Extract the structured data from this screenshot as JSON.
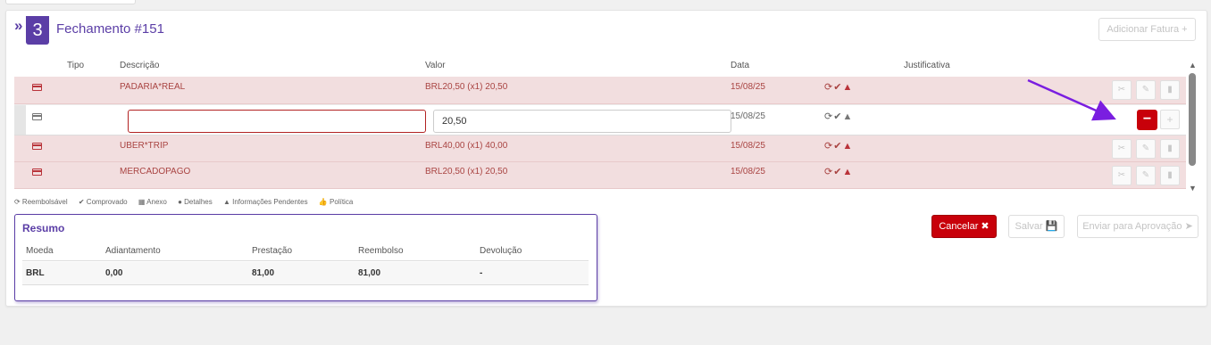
{
  "header": {
    "chevron": "»",
    "step": "3",
    "title": "Fechamento #151",
    "add_invoice_label": "Adicionar Fatura",
    "add_invoice_icon": "+"
  },
  "table": {
    "columns": [
      "Tipo",
      "Descrição",
      "Valor",
      "Data",
      "Justificativa"
    ],
    "rows": [
      {
        "description": "PADARIA*REAL",
        "value": "BRL20,50 (x1) 20,50",
        "date": "15/08/25"
      },
      {
        "description": "",
        "value": "20,50",
        "date": "15/08/25",
        "editing": true
      },
      {
        "description": "UBER*TRIP",
        "value": "BRL40,00 (x1) 40,00",
        "date": "15/08/25"
      },
      {
        "description": "MERCADOPAGO",
        "value": "BRL20,50 (x1) 20,50",
        "date": "15/08/25"
      }
    ],
    "status_glyphs": "⟳✔",
    "warn_glyph": "▲",
    "remove_glyph": "−",
    "plus_glyph": "+"
  },
  "legend": [
    "⟳ Reembolsável",
    "✔ Comprovado",
    "▦ Anexo",
    "● Detalhes",
    "▲ Informações Pendentes",
    "👍 Política"
  ],
  "resumo": {
    "title": "Resumo",
    "headers": [
      "Moeda",
      "Adiantamento",
      "Prestação",
      "Reembolso",
      "Devolução"
    ],
    "row": [
      "BRL",
      "0,00",
      "81,00",
      "81,00",
      "-"
    ]
  },
  "actions": {
    "cancel_label": "Cancelar ✖",
    "save_label": "Salvar 💾",
    "send_label": "Enviar para Aprovação ➤"
  },
  "colors": {
    "accent": "#5b3ea6",
    "danger": "#c8000a",
    "row_error_bg": "#f2dedf",
    "row_error_text": "#a94442"
  }
}
